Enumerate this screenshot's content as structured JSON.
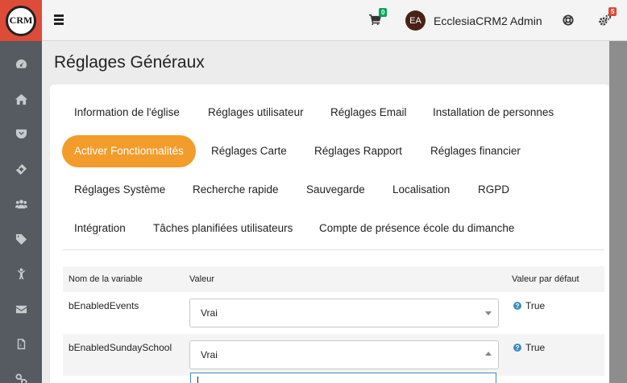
{
  "app": {
    "logo_text": "CRM"
  },
  "topbar": {
    "cart_count": "0",
    "user_initials": "EA",
    "user_name": "EcclesiaCRM2 Admin",
    "notifications_count": "5"
  },
  "page": {
    "title": "Réglages Généraux"
  },
  "tabs": [
    {
      "label": "Information de l'église"
    },
    {
      "label": "Réglages utilisateur"
    },
    {
      "label": "Réglages Email"
    },
    {
      "label": "Installation de personnes"
    },
    {
      "label": "Activer Fonctionnalités",
      "active": true
    },
    {
      "label": "Réglages Carte"
    },
    {
      "label": "Réglages Rapport"
    },
    {
      "label": "Réglages financier"
    },
    {
      "label": "Réglages Système"
    },
    {
      "label": "Recherche rapide"
    },
    {
      "label": "Sauvegarde"
    },
    {
      "label": "Localisation"
    },
    {
      "label": "RGPD"
    },
    {
      "label": "Intégration"
    },
    {
      "label": "Tâches planifiées utilisateurs"
    },
    {
      "label": "Compte de présence école du dimanche"
    }
  ],
  "table": {
    "headers": {
      "name": "Nom de la variable",
      "value": "Valeur",
      "default": "Valeur par défaut"
    },
    "rows": [
      {
        "name": "bEnabledEvents",
        "value": "Vrai",
        "default": "True"
      },
      {
        "name": "bEnabledSundaySchool",
        "value": "Vrai",
        "default": "True"
      }
    ]
  },
  "colors": {
    "accent": "#f39c2b",
    "sidebar": "#555b60",
    "logo_bg": "#dd4b39",
    "info": "#3c8dbc",
    "badge_green": "#00a65a",
    "badge_red": "#dd4b39"
  }
}
